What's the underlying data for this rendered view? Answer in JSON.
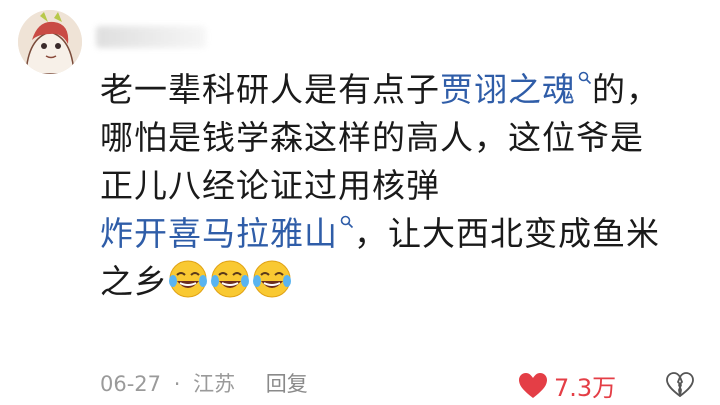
{
  "comment": {
    "lines": [
      {
        "text_before": "老一辈科研人是有点子",
        "topic": "贾诩之魂",
        "text_after": "的，"
      },
      {
        "text": "哪怕是钱学森这样的高人，这位爷是"
      },
      {
        "text": "正儿八经论证过用核弹"
      },
      {
        "topic": "炸开喜马拉雅山",
        "text_after": "，让大西北变成鱼米"
      },
      {
        "text": "之乡",
        "emojis": [
          "laugh-cry-emoji",
          "laugh-cry-emoji",
          "laugh-cry-emoji"
        ]
      }
    ]
  },
  "meta": {
    "date": "06-27",
    "separator": "·",
    "location": "江苏",
    "reply_label": "回复"
  },
  "likes": {
    "count": "7.3万",
    "color": "#e43e46"
  },
  "colors": {
    "topic_link": "#2f5da8",
    "text": "#1a1a1a",
    "meta": "#9a9a9a"
  }
}
